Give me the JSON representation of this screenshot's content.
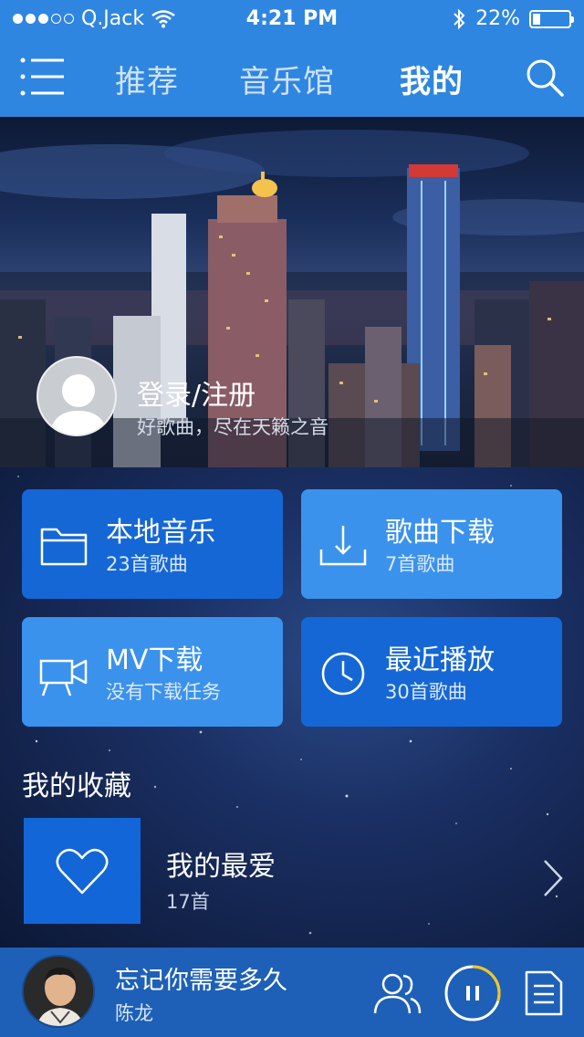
{
  "status_bar": {
    "carrier": "Q.Jack",
    "time": "4:21 PM",
    "battery": "22%",
    "battery_level": 0.22
  },
  "nav": {
    "menu_icon": "hamburger-menu-icon",
    "tabs": [
      {
        "label": "推荐",
        "active": false
      },
      {
        "label": "音乐馆",
        "active": false
      },
      {
        "label": "我的",
        "active": true
      }
    ],
    "search_icon": "search-icon"
  },
  "profile": {
    "login": "登录/注册",
    "tagline": "好歌曲，尽在天籁之音"
  },
  "tiles": [
    {
      "title": "本地音乐",
      "subtitle": "23首歌曲",
      "icon": "folder-icon"
    },
    {
      "title": "歌曲下载",
      "subtitle": "7首歌曲",
      "icon": "download-icon"
    },
    {
      "title": "MV下载",
      "subtitle": "没有下载任务",
      "icon": "video-camera-icon"
    },
    {
      "title": "最近播放",
      "subtitle": "30首歌曲",
      "icon": "clock-icon"
    }
  ],
  "favorites": {
    "heading": "我的收藏",
    "item": {
      "title": "我的最爱",
      "count": "17首",
      "icon": "heart-icon"
    }
  },
  "player": {
    "song": "忘记你需要多久",
    "artist": "陈龙",
    "progress": 0.3,
    "colors": {
      "accent": "#f5c518",
      "bar": "#1e60b7",
      "header": "#2f86e0"
    }
  }
}
